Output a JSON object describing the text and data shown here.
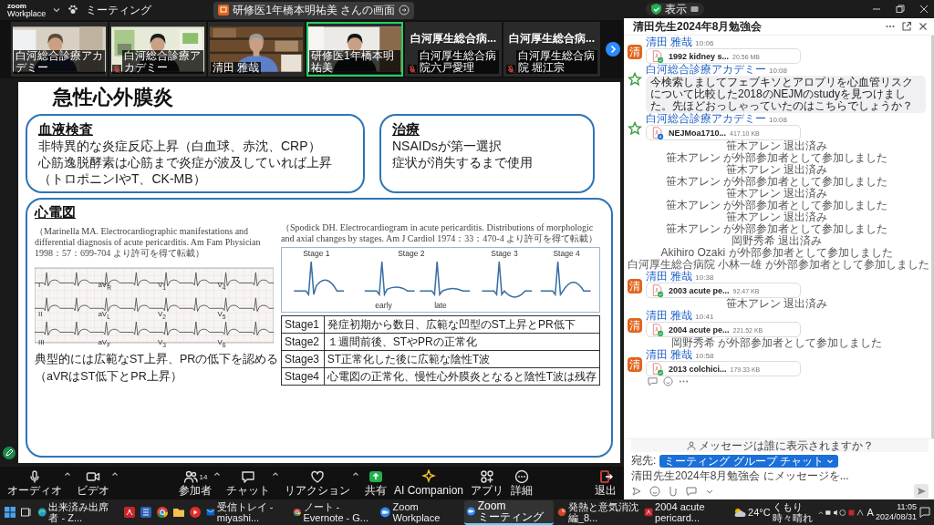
{
  "top_bar": {
    "logo_line1": "zoom",
    "logo_line2": "Workplace",
    "meeting_label": "ミーティング",
    "share_label": "研修医1年橋本明祐美 さんの画面"
  },
  "participants": [
    {
      "kind": "video",
      "name": "白河総合診療アカデミー",
      "muted": false,
      "speaking": false
    },
    {
      "kind": "video",
      "name": "白河総合診療アカデミー",
      "muted": true,
      "speaking": false
    },
    {
      "kind": "video",
      "name": "清田 雅哉",
      "muted": false,
      "speaking": false
    },
    {
      "kind": "video",
      "name": "研修医1年橋本明祐美",
      "muted": false,
      "speaking": true
    },
    {
      "kind": "name",
      "title": "白河厚生総合病...",
      "name": "白河厚生総合病院六戸愛理",
      "muted": true,
      "speaking": false
    },
    {
      "kind": "name",
      "title": "白河厚生総合病...",
      "name": "白河厚生総合病院 堀江宗",
      "muted": true,
      "speaking": false
    }
  ],
  "slide": {
    "title": "急性心外膜炎",
    "blood_test": {
      "heading": "血液検査",
      "lines": [
        "非特異的な炎症反応上昇（白血球、赤沈、CRP）",
        "心筋逸脱酵素は心筋まで炎症が波及していれば上昇",
        "（トロポニンIやT、CK-MB）"
      ]
    },
    "treatment": {
      "heading": "治療",
      "lines": [
        "NSAIDsが第一選択",
        "症状が消失するまで使用"
      ]
    },
    "ecg": {
      "heading": "心電図",
      "left_citation": "（Marinella MA. Electrocardiographic manifestations and differential diagnosis of acute pericarditis. Am Fam Physician 1998：57：699-704 より許可を得て転載）",
      "leads": [
        "I",
        "aV$_{R}$",
        "V$_{1}$",
        "V$_{4}$",
        "II",
        "aV$_{L}$",
        "V$_{2}$",
        "V$_{5}$",
        "III",
        "aV$_{F}$",
        "V$_{3}$",
        "V$_{6}$"
      ],
      "caption_lines": [
        "典型的には広範なST上昇、PRの低下を認める",
        "（aVRはST低下とPR上昇）"
      ],
      "right_citation": "（Spodick DH. Electrocardiogram in acute pericarditis. Distributions of morphologic and axial changes by stages. Am J Cardiol 1974：33：470-4 より許可を得て転載）",
      "stages": [
        "Stage 1",
        "Stage 2",
        "Stage 3",
        "Stage 4"
      ],
      "stage2_sublabels": [
        "early",
        "late"
      ],
      "table": [
        {
          "stage": "Stage1",
          "text": "発症初期から数日、広範な凹型のST上昇とPR低下"
        },
        {
          "stage": "Stage2",
          "text": "１週間前後、STやPRの正常化"
        },
        {
          "stage": "Stage3",
          "text": "ST正常化した後に広範な陰性T波"
        },
        {
          "stage": "Stage4",
          "text": "心電図の正常化、慢性心外膜炎となると陰性T波は残存"
        }
      ]
    }
  },
  "toolbar": [
    {
      "kind": "audio",
      "label": "オーディオ",
      "caret": true
    },
    {
      "kind": "video",
      "label": "ビデオ",
      "caret": true
    },
    {
      "kind": "participants",
      "label": "参加者",
      "count": "14",
      "caret": true
    },
    {
      "kind": "chat",
      "label": "チャット",
      "caret": true
    },
    {
      "kind": "reactions",
      "label": "リアクション",
      "caret": true
    },
    {
      "kind": "share",
      "label": "共有",
      "caret": false
    },
    {
      "kind": "ai",
      "label": "AI Companion",
      "caret": false
    },
    {
      "kind": "apps",
      "label": "アプリ",
      "caret": false
    },
    {
      "kind": "more",
      "label": "詳細",
      "caret": false
    },
    {
      "kind": "leave",
      "label": "退出",
      "caret": false
    }
  ],
  "chat": {
    "view_label": "表示",
    "title": "清田先生2024年8月勉強会",
    "items": [
      {
        "kind": "file",
        "sender": "清田 雅哉",
        "time": "10:06",
        "avatar": {
          "kind": "initial",
          "text": "清"
        },
        "file_name": "1992 kidney s...",
        "size": "20.56 MB",
        "complete": true
      },
      {
        "kind": "text",
        "sender": "白河総合診療アカデミー",
        "time": "10:08",
        "avatar": {
          "kind": "logo"
        },
        "text": "今検索しましてフェブキソとアロプリを心血管リスクについて比較した2018のNEJMのstudyを見つけました。先ほどおっしゃっていたのはこちらでしょうか？"
      },
      {
        "kind": "file",
        "sender": "白河総合診療アカデミー",
        "time": "10:08",
        "avatar": {
          "kind": "logo"
        },
        "file_name": "NEJMoa1710...",
        "size": "417.10 KB",
        "complete": false
      },
      {
        "kind": "system",
        "text": "笹木アレン 退出済み"
      },
      {
        "kind": "system",
        "text": "笹木アレン が外部参加者として参加しました"
      },
      {
        "kind": "system",
        "text": "笹木アレン 退出済み"
      },
      {
        "kind": "system",
        "text": "笹木アレン が外部参加者として参加しました"
      },
      {
        "kind": "system",
        "text": "笹木アレン 退出済み"
      },
      {
        "kind": "system",
        "text": "笹木アレン が外部参加者として参加しました"
      },
      {
        "kind": "system",
        "text": "笹木アレン 退出済み"
      },
      {
        "kind": "system",
        "text": "笹木アレン が外部参加者として参加しました"
      },
      {
        "kind": "system",
        "text": "岡野秀希 退出済み"
      },
      {
        "kind": "system",
        "text": "Akihiro Ozaki が外部参加者として参加しました"
      },
      {
        "kind": "system",
        "text": "白河厚生総合病院 小林一雄 が外部参加者として参加しました"
      },
      {
        "kind": "file",
        "sender": "清田 雅哉",
        "time": "10:38",
        "avatar": {
          "kind": "initial",
          "text": "清"
        },
        "file_name": "2003 acute pe...",
        "size": "92.47 KB",
        "complete": true
      },
      {
        "kind": "system",
        "text": "笹木アレン 退出済み"
      },
      {
        "kind": "file",
        "sender": "清田 雅哉",
        "time": "10:41",
        "avatar": {
          "kind": "initial",
          "text": "清"
        },
        "file_name": "2004 acute pe...",
        "size": "221.52 KB",
        "complete": true
      },
      {
        "kind": "system",
        "text": "岡野秀希 が外部参加者として参加しました"
      },
      {
        "kind": "file",
        "sender": "清田 雅哉",
        "time": "10:58",
        "avatar": {
          "kind": "initial",
          "text": "清"
        },
        "file_name": "2013 colchici...",
        "size": "179.33 KB",
        "complete": true
      }
    ],
    "visibility_prompt": "メッセージは誰に表示されますか？",
    "recipient_label": "宛先:",
    "recipient": "ミーティング グループ チャット",
    "placeholder": "清田先生2024年8月勉強会 にメッセージを..."
  },
  "taskbar": {
    "tasks": [
      {
        "kind": "edge",
        "label": "出来済み出席者 - Z...",
        "selected": false
      },
      {
        "kind": "acrobat",
        "selected": false
      },
      {
        "kind": "word",
        "selected": false
      },
      {
        "kind": "chrome",
        "selected": false
      },
      {
        "kind": "folder",
        "selected": false
      },
      {
        "kind": "youtube",
        "selected": false
      },
      {
        "kind": "outlook",
        "label": "受信トレイ - miyashi...",
        "selected": false
      },
      {
        "kind": "chrome",
        "label": "ノート - Evernote - G...",
        "selected": false
      },
      {
        "kind": "zoom",
        "label": "Zoom Workplace",
        "selected": false
      },
      {
        "kind": "zoom",
        "label": "Zoom ミーティング",
        "selected": true
      },
      {
        "kind": "powerpoint",
        "label": "発熱と意気消沈編_8...",
        "selected": false
      },
      {
        "kind": "acrobat",
        "label": "2004 acute pericard...",
        "selected": false
      }
    ],
    "weather": {
      "temp": "24°C",
      "condition": "くもり時々晴れ"
    },
    "ime": "A",
    "clock": {
      "time": "11:05",
      "date": "2024/08/31"
    }
  }
}
